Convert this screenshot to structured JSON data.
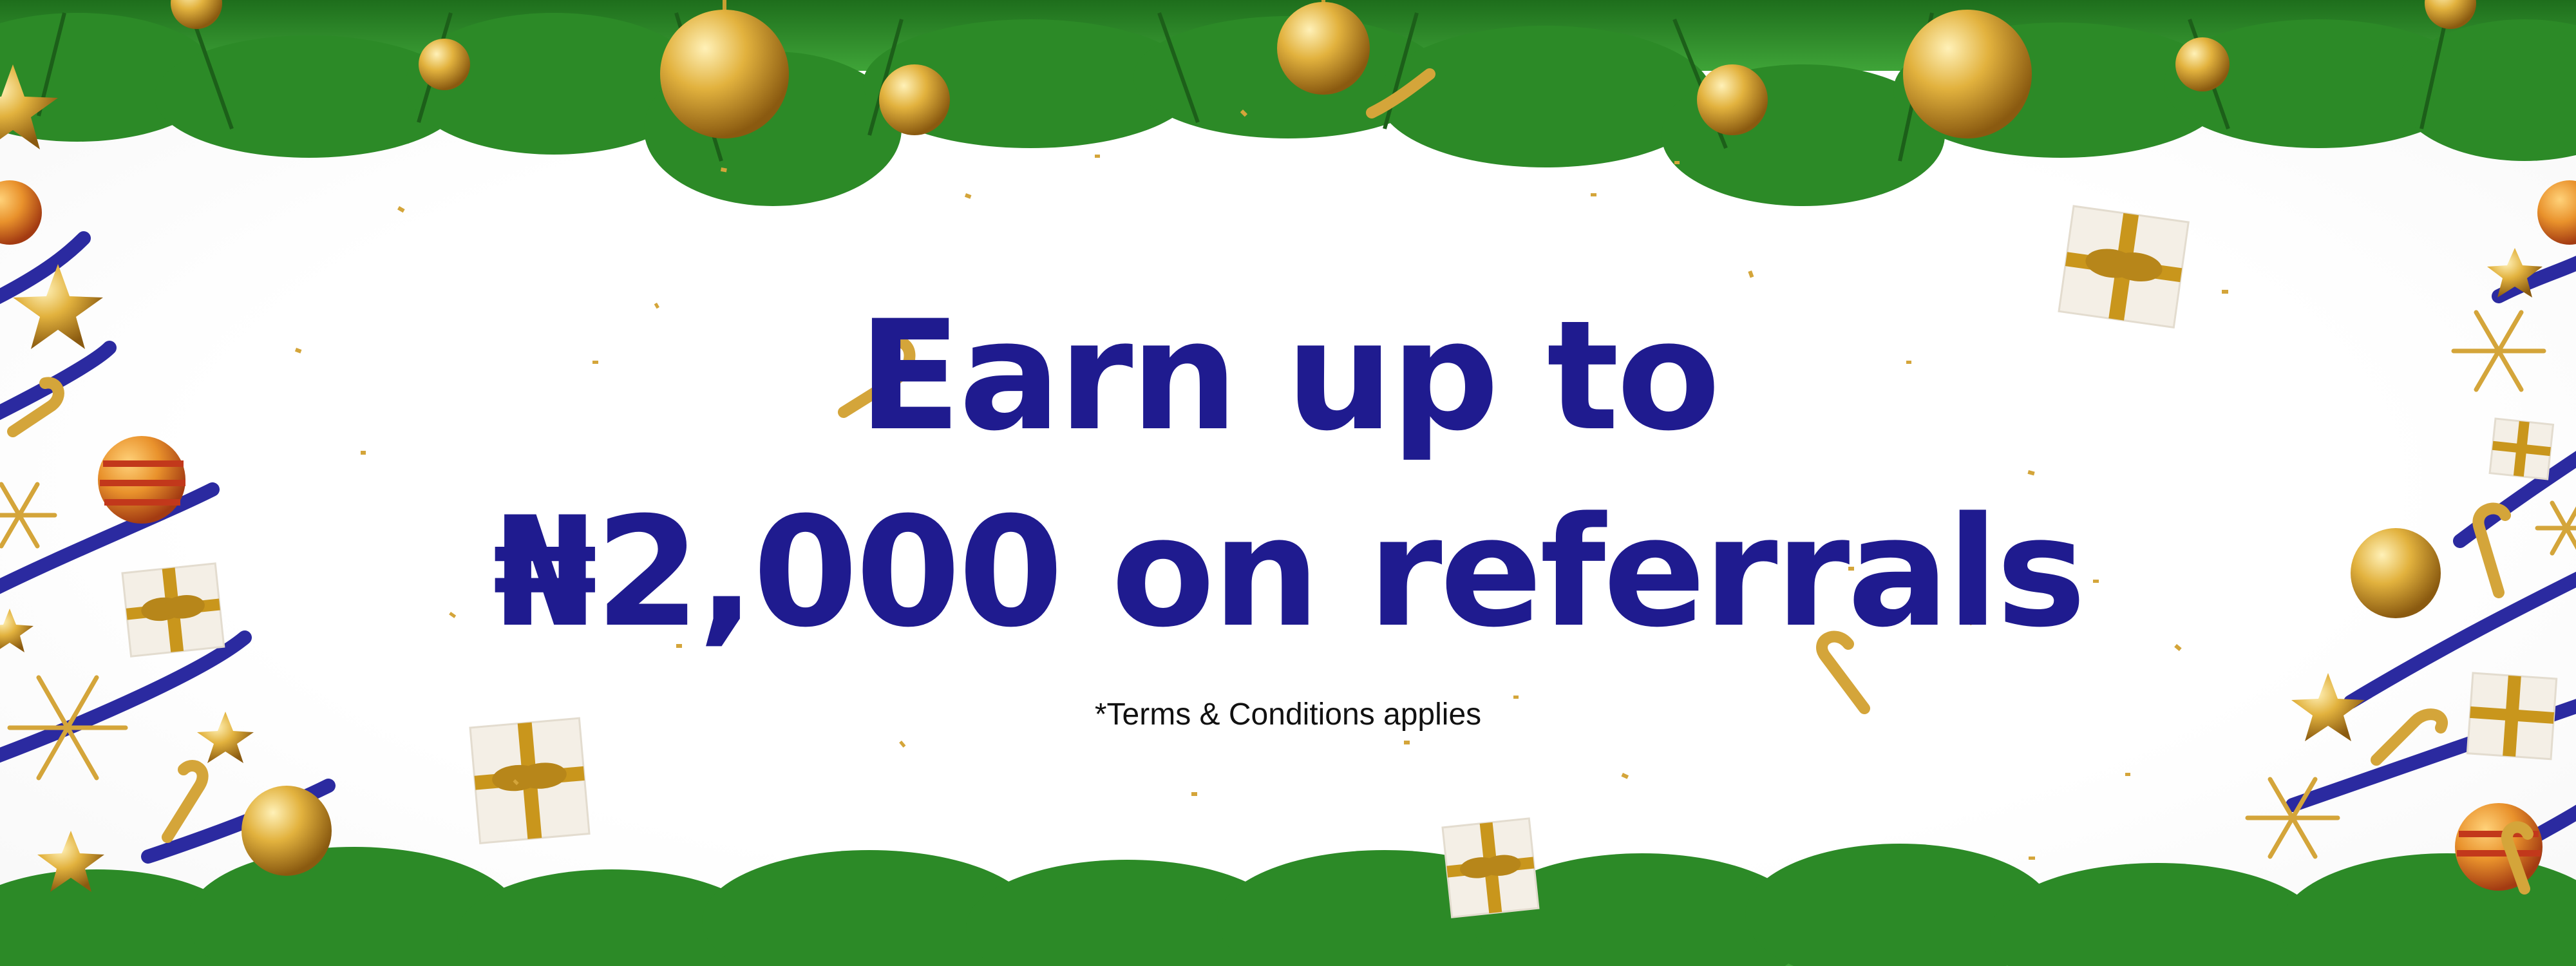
{
  "banner": {
    "headline_line1": "Earn up to",
    "headline_line2": "₦2,000 on referrals",
    "terms": "*Terms & Conditions applies"
  },
  "colors": {
    "headline": "#1f1b8f",
    "ribbon": "#2b2aa0",
    "gold": "#d9a730",
    "pine": "#2f8f2a"
  },
  "icons": [
    "pine-garland-icon",
    "gold-bauble-icon",
    "candy-cane-icon",
    "gift-box-icon",
    "star-icon",
    "snowflake-icon",
    "confetti-icon",
    "ribbon-icon"
  ]
}
